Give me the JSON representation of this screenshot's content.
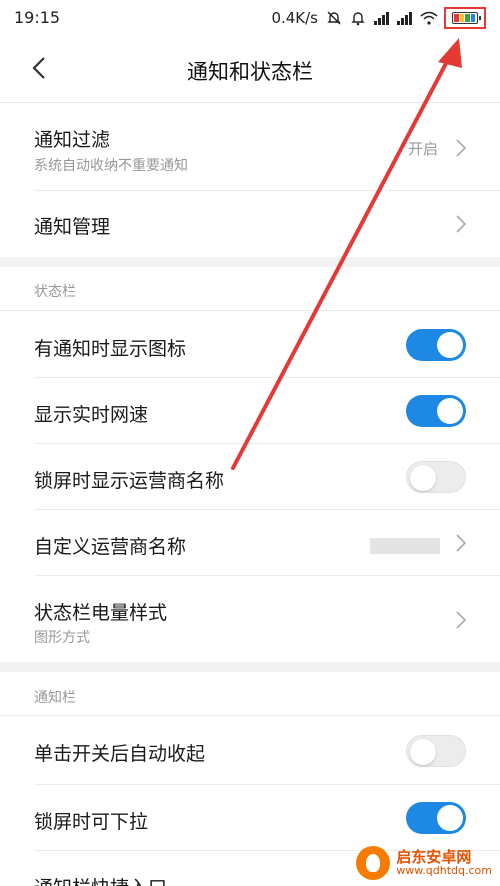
{
  "status_bar": {
    "time": "19:15",
    "net_speed": "0.4K/s",
    "icons": [
      "mute-notification-icon",
      "bell-icon",
      "signal-icon",
      "signal-icon",
      "wifi-icon",
      "battery-icon"
    ],
    "battery_colors": [
      "#e53935",
      "#fbc02d",
      "#43a047",
      "#1e88e5"
    ],
    "highlight_color": "#e53935"
  },
  "header": {
    "title": "通知和状态栏",
    "back_icon": "back-chevron-icon"
  },
  "notification_filter": {
    "title": "通知过滤",
    "subtitle": "系统自动收纳不重要通知",
    "value": "开启"
  },
  "notification_manage": {
    "title": "通知管理"
  },
  "status_bar_section": {
    "label": "状态栏",
    "items": [
      {
        "title": "有通知时显示图标",
        "toggle": "on"
      },
      {
        "title": "显示实时网速",
        "toggle": "on"
      },
      {
        "title": "锁屏时显示运营商名称",
        "toggle": "off"
      }
    ],
    "custom_carrier": {
      "title": "自定义运营商名称"
    },
    "battery_style": {
      "title": "状态栏电量样式",
      "subtitle": "图形方式"
    }
  },
  "notification_bar_section": {
    "label": "通知栏",
    "items": [
      {
        "title": "单击开关后自动收起",
        "toggle": "off"
      },
      {
        "title": "锁屏时可下拉",
        "toggle": "on"
      }
    ],
    "shortcut": {
      "title": "通知栏快捷入口"
    }
  },
  "colors": {
    "accent": "#1e88e5",
    "annotation": "#e53935"
  },
  "watermark": {
    "line1": "启东安卓网",
    "line2": "www.qdhtdq.com"
  }
}
